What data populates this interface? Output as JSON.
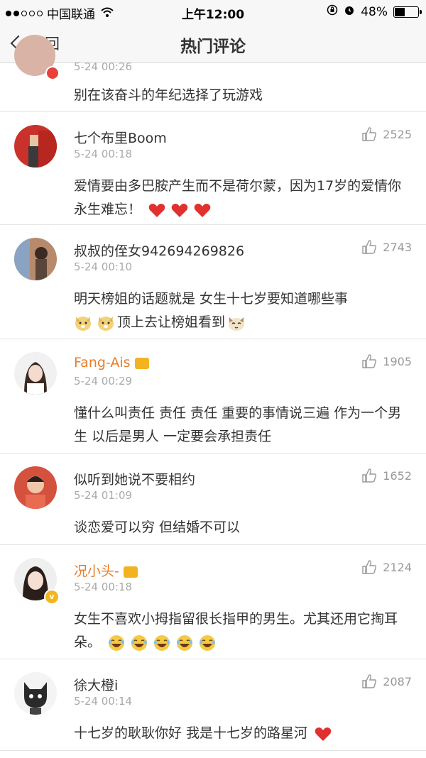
{
  "status_bar": {
    "carrier": "中国联通",
    "time": "上午12:00",
    "battery": "48%",
    "battery_level": 0.48
  },
  "nav": {
    "back_label": "返回",
    "title": "热门评论"
  },
  "partial": {
    "time": "5-24 00:26",
    "text": "别在该奋斗的年纪选择了玩游戏"
  },
  "comments": [
    {
      "username": "七个布里Boom",
      "time": "5-24 00:18",
      "likes": "2525",
      "text": "爱情要由多巴胺产生而不是荷尔蒙，因为17岁的爱情你永生难忘！",
      "emojis": [
        "heart",
        "heart",
        "heart"
      ]
    },
    {
      "username": "叔叔的侄女942694269826",
      "time": "5-24 00:10",
      "likes": "2743",
      "text_line1": "明天榜姐的话题就是  女生十七岁要知道哪些事",
      "text_line2": "顶上去让榜姐看到",
      "emojis": [
        "doge",
        "doge",
        "cat"
      ]
    },
    {
      "username": "Fang-Ais",
      "time": "5-24 00:29",
      "likes": "1905",
      "text": "懂什么叫责任 责任 责任 重要的事情说三遍 作为一个男生 以后是男人 一定要会承担责任"
    },
    {
      "username": "似听到她说不要相约",
      "time": "5-24 01:09",
      "likes": "1652",
      "text": "谈恋爱可以穷 但结婚不可以"
    },
    {
      "username": "况小头-",
      "time": "5-24 00:18",
      "likes": "2124",
      "text": "女生不喜欢小拇指留很长指甲的男生。尤其还用它掏耳朵。",
      "emojis": [
        "laugh",
        "laugh",
        "laugh",
        "laugh",
        "laugh"
      ]
    },
    {
      "username": "徐大橙i",
      "time": "5-24 00:14",
      "likes": "2087",
      "text": "十七岁的耿耿你好 我是十七岁的路星河",
      "emojis": [
        "heart"
      ]
    }
  ],
  "colors": {
    "accent_vip": "#e67d2b",
    "heart": "#e0312f",
    "emoji_yellow": "#f6c945"
  }
}
